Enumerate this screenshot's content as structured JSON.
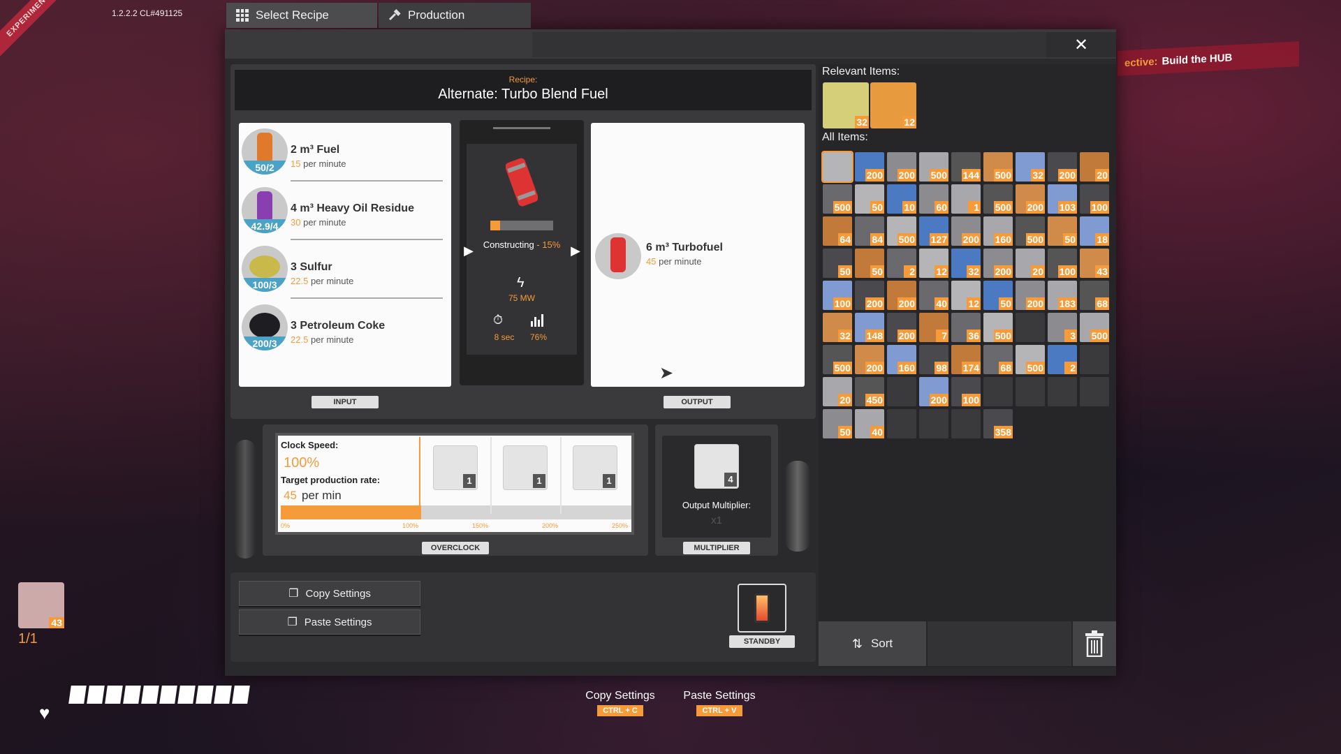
{
  "hud": {
    "version": "1.2.2.2 CL#491125",
    "banner": "EXPERIMENTAL BUILD",
    "objective_label": "ective:",
    "objective_text": "Build the HUB",
    "hotbar_count": "43",
    "slots": "1/1",
    "health_segments": 10
  },
  "tabs": {
    "select_recipe": "Select Recipe",
    "production": "Production",
    "close": "✕"
  },
  "recipe": {
    "label": "Recipe:",
    "name": "Alternate: Turbo Blend Fuel"
  },
  "inputs": [
    {
      "name": "2 m³ Fuel",
      "rate": "15",
      "rate_unit": "per minute",
      "badge": "50/2",
      "color": "#e07a2a"
    },
    {
      "name": "4 m³ Heavy Oil Residue",
      "rate": "30",
      "rate_unit": "per minute",
      "badge": "42.9/4",
      "color": "#8a3fb0"
    },
    {
      "name": "3 Sulfur",
      "rate": "22.5",
      "rate_unit": "per minute",
      "badge": "100/3",
      "color": "#c9b84a"
    },
    {
      "name": "3 Petroleum Coke",
      "rate": "22.5",
      "rate_unit": "per minute",
      "badge": "200/3",
      "color": "#1d1d22"
    }
  ],
  "machine": {
    "status": "Constructing",
    "progress_text": "15%",
    "progress": 0.15,
    "power": "75 MW",
    "cycle_time": "8 sec",
    "efficiency": "76%"
  },
  "output": {
    "name": "6 m³ Turbofuel",
    "rate": "45",
    "rate_unit": "per minute"
  },
  "labels": {
    "input": "INPUT",
    "output": "OUTPUT",
    "overclock": "OVERCLOCK",
    "multiplier": "MULTIPLIER",
    "standby": "STANDBY"
  },
  "overclock": {
    "clock_label": "Clock Speed:",
    "clock_value": "100%",
    "target_label": "Target production rate:",
    "target_value": "45",
    "target_unit": "per min",
    "fill_fraction": 0.4,
    "ticks": [
      "0%",
      "100%",
      "150%",
      "200%",
      "250%"
    ],
    "shards": [
      "1",
      "1",
      "1"
    ]
  },
  "multiplier": {
    "count": "4",
    "label": "Output Multiplier:",
    "value": "x1"
  },
  "settings": {
    "copy": "Copy Settings",
    "paste": "Paste Settings"
  },
  "items": {
    "relevant_label": "Relevant Items:",
    "relevant": [
      {
        "count": "32",
        "color": "#d6cf7a"
      },
      {
        "count": "12",
        "color": "#e79a3e"
      }
    ],
    "all_label": "All Items:",
    "grid": [
      [
        "",
        "200",
        "200",
        "500",
        "144",
        "500",
        "32",
        "200",
        "20"
      ],
      [
        "500",
        "50",
        "10",
        "60",
        "1",
        "500",
        "200",
        "103",
        "100"
      ],
      [
        "64",
        "84",
        "500",
        "127",
        "200",
        "160",
        "500",
        "50",
        "18"
      ],
      [
        "50",
        "50",
        "2",
        "12",
        "32",
        "200",
        "20",
        "100",
        "43"
      ],
      [
        "100",
        "200",
        "200",
        "40",
        "12",
        "50",
        "200",
        "183",
        "68"
      ],
      [
        "32",
        "148",
        "200",
        "7",
        "36",
        "500",
        "-",
        "3",
        "500"
      ],
      [
        "500",
        "200",
        "160",
        "98",
        "174",
        "68",
        "500",
        "2",
        "-"
      ],
      [
        "20",
        "450",
        "-",
        "200",
        "100",
        "-",
        "-",
        "-",
        "-"
      ],
      [
        "50",
        "40",
        "-",
        "-",
        "-",
        "358",
        null,
        null,
        null
      ]
    ],
    "sort": "Sort"
  },
  "hints": [
    {
      "label": "Copy Settings",
      "key": "CTRL + C"
    },
    {
      "label": "Paste Settings",
      "key": "CTRL + V"
    }
  ]
}
